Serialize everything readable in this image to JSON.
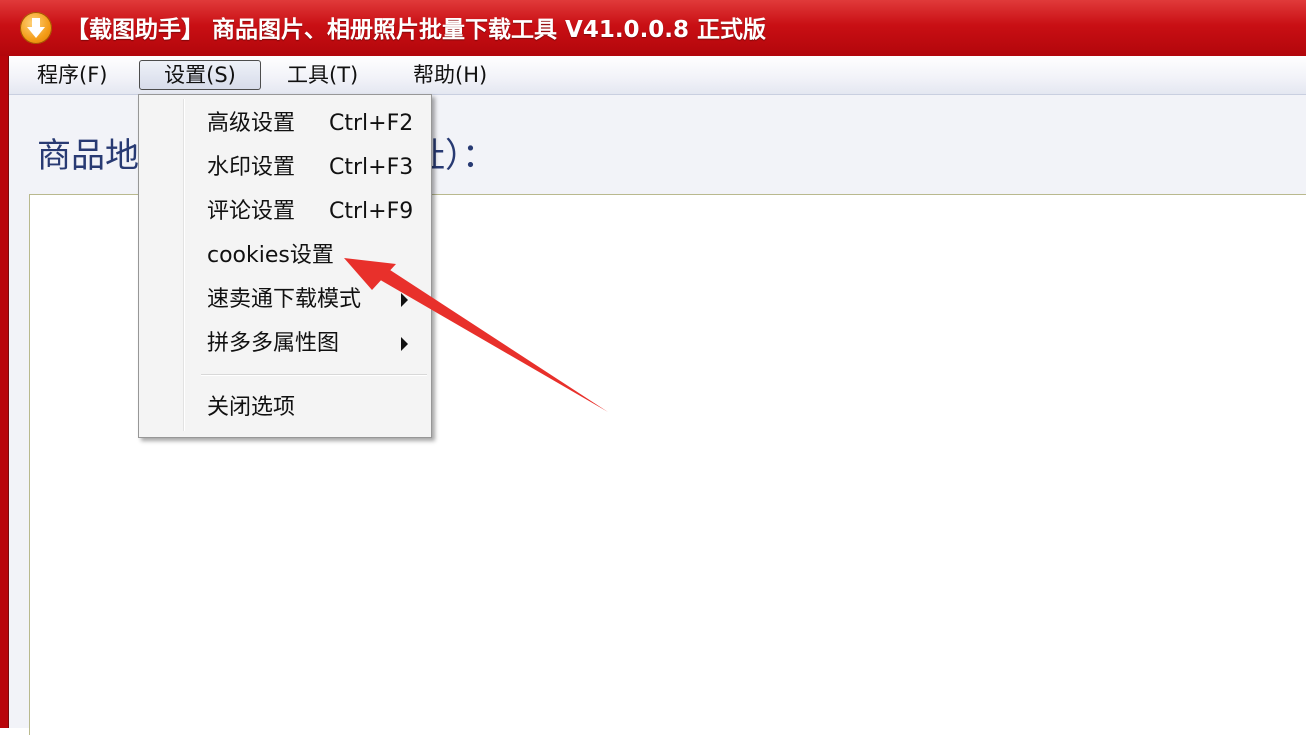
{
  "window": {
    "title": "【载图助手】 商品图片、相册照片批量下载工具 V41.0.0.8 正式版",
    "icon": "download-arrow-icon"
  },
  "menubar": {
    "items": [
      {
        "label": "程序(F)",
        "active": false
      },
      {
        "label": "设置(S)",
        "active": true
      },
      {
        "label": "工具(T)",
        "active": false
      },
      {
        "label": "帮助(H)",
        "active": false
      }
    ]
  },
  "main": {
    "label_left": "商品地",
    "label_right": "址）："
  },
  "settings_menu": {
    "items": [
      {
        "label": "高级设置",
        "shortcut": "Ctrl+F2"
      },
      {
        "label": "水印设置",
        "shortcut": "Ctrl+F3"
      },
      {
        "label": "评论设置",
        "shortcut": "Ctrl+F9"
      },
      {
        "label": "cookies设置",
        "shortcut": ""
      },
      {
        "label": "速卖通下载模式",
        "submenu": true
      },
      {
        "label": "拼多多属性图",
        "submenu": true
      },
      {
        "label": "关闭选项",
        "shortcut": ""
      }
    ]
  },
  "annotation": {
    "type": "red-arrow",
    "target": "cookies设置",
    "color": "#e8302b"
  },
  "colors": {
    "titlebar": "#c90f14",
    "label_text": "#283a73",
    "menu_background": "#f4f4f4"
  }
}
